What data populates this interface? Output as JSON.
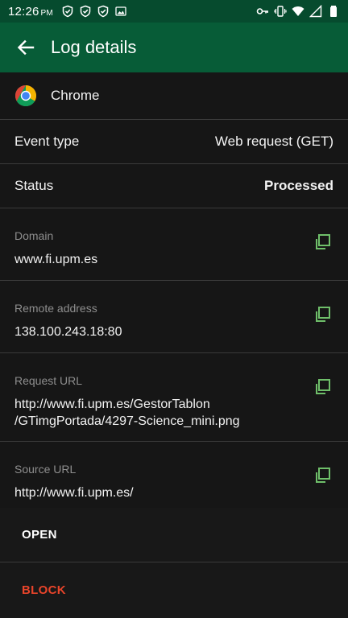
{
  "status_bar": {
    "time": "12:26",
    "ampm": "PM",
    "left_icons": [
      "shield-check-icon",
      "shield-check-icon",
      "shield-check-icon",
      "image-icon"
    ],
    "right_icons": [
      "key-icon",
      "vibrate-icon",
      "wifi-icon",
      "cellular-icon",
      "battery-icon"
    ]
  },
  "app_bar": {
    "title": "Log details",
    "back_icon": "arrow-back-icon",
    "background": "#075c37"
  },
  "app": {
    "name": "Chrome",
    "icon": "chrome-logo"
  },
  "fields": [
    {
      "label": "Event type",
      "value": "Web request (GET)"
    },
    {
      "label": "Status",
      "value": "Processed"
    }
  ],
  "details": [
    {
      "label": "Domain",
      "value": "www.fi.upm.es"
    },
    {
      "label": "Remote address",
      "value": "138.100.243.18:80"
    },
    {
      "label": "Request URL",
      "value_line1": "http://www.fi.upm.es/GestorTablon",
      "value_line2": "/GTimgPortada/4297-Science_mini.png"
    },
    {
      "label": "Source URL",
      "value": "http://www.fi.upm.es/"
    }
  ],
  "copy_icon": "copy-icon",
  "copy_icon_color": "#6fbf6a",
  "actions": {
    "open_label": "OPEN",
    "block_label": "BLOCK",
    "block_color": "#e8442a"
  }
}
